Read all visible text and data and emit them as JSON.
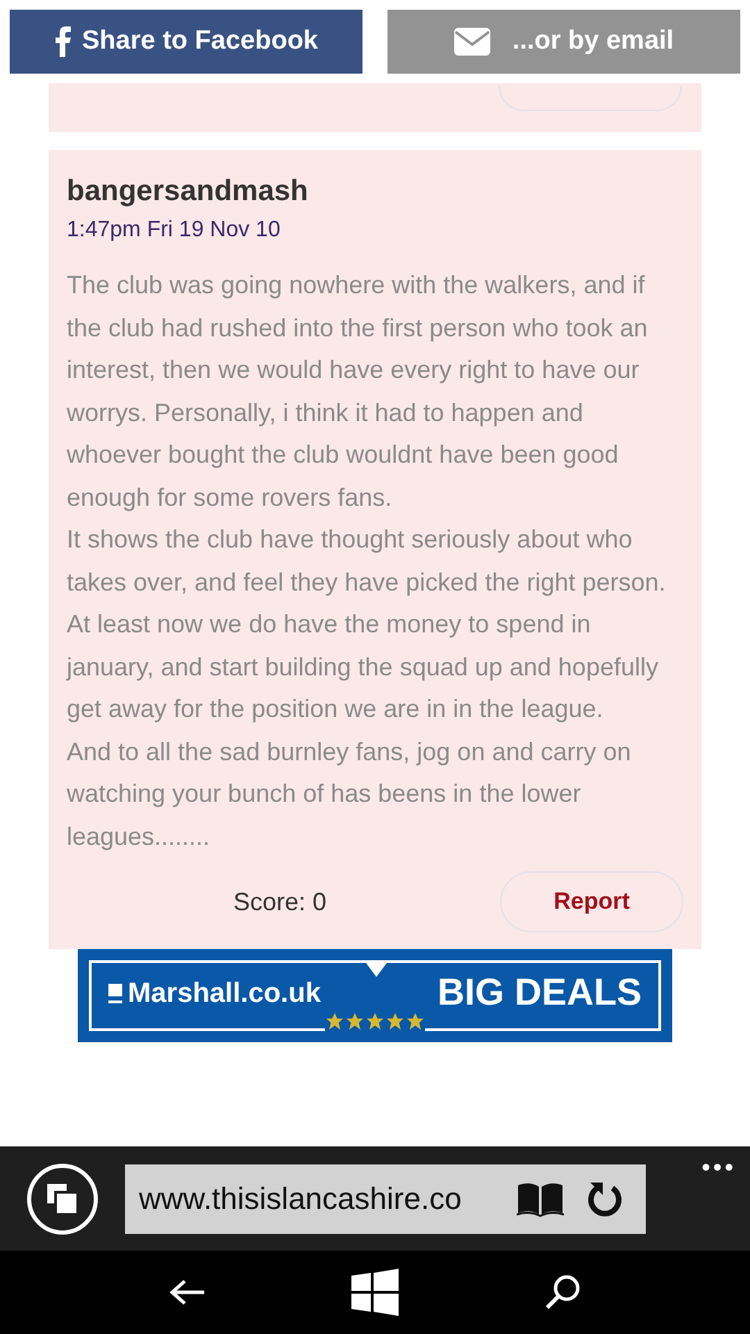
{
  "share_bar": {
    "facebook_button": "Share to Facebook",
    "email_button": "...or by email"
  },
  "comments": [
    {
      "author": "bangersandmash",
      "time": "1:47pm Fri 19 Nov 10",
      "paragraphs": [
        "The club was going nowhere with the walkers, and if the club had rushed into the first person who took an interest, then we would have every right to have our worrys. Personally, i think it had to happen and whoever bought the club wouldnt have been good enough for some rovers fans.",
        "It shows the club have thought seriously about who takes over, and feel they have picked the right person.",
        "At least now we do have the money to spend in january, and start building the squad up and hopefully get away for the position we are in in the league.",
        "And to all the sad burnley fans, jog on and carry on watching your bunch of has beens in the lower leagues........"
      ],
      "score": "Score: 0",
      "report_button": "Report"
    }
  ],
  "ad": {
    "brand": "Marshall.co.uk",
    "headline": "BIG DEALS"
  },
  "browser": {
    "address": "www.thisislancashire.co",
    "more": "•••"
  }
}
